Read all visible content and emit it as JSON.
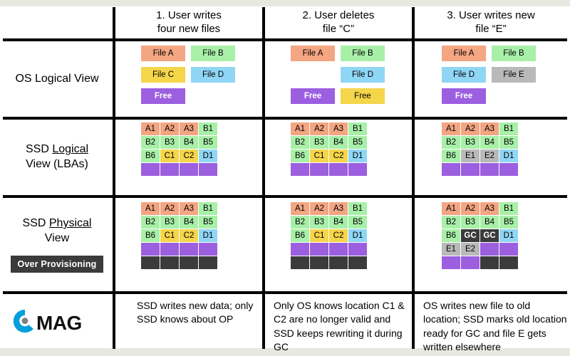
{
  "page": {
    "title": "SSD Over Provisioning and Garbage Collection Diagram",
    "band_color": "#e8e8e0"
  },
  "palette": {
    "orange": "#f4a582",
    "green": "#a8f0a8",
    "yellow": "#f5d54a",
    "blue": "#8fd6f5",
    "purple": "#9b5fe0",
    "gray": "#b9b9b9",
    "dark": "#3b3b3b",
    "white": "#ffffff",
    "rule": "#000000",
    "logo_blue": "#00a0dc",
    "logo_dot": "#808080",
    "logo_text": "#111111"
  },
  "columns": [
    {
      "id": "col1",
      "header_line1": "1. User writes",
      "header_line2": "four  new files"
    },
    {
      "id": "col2",
      "header_line1": "2. User deletes",
      "header_line2": "file “C”"
    },
    {
      "id": "col3",
      "header_line1": "3. User writes new",
      "header_line2": "file “E”"
    }
  ],
  "rows": {
    "os_logical": {
      "label_line1": "OS Logical",
      "label_line2": "View"
    },
    "ssd_logical": {
      "label_pre": "SSD ",
      "label_underlined": "Logical",
      "label_line2": "View (LBAs)"
    },
    "ssd_physical": {
      "label_pre": "SSD ",
      "label_underlined": "Physical",
      "label_line2": "View",
      "badge": "Over Provisioning"
    }
  },
  "os_view": {
    "col1": [
      [
        {
          "label": "File A",
          "color": "orange"
        },
        {
          "label": "File B",
          "color": "green"
        }
      ],
      [
        {
          "label": "File C",
          "color": "yellow"
        },
        {
          "label": "File D",
          "color": "blue"
        }
      ],
      [
        {
          "label": "Free",
          "color": "purple"
        },
        {
          "label": "",
          "color": "empty"
        }
      ]
    ],
    "col2": [
      [
        {
          "label": "File A",
          "color": "orange"
        },
        {
          "label": "File B",
          "color": "green"
        }
      ],
      [
        {
          "label": "",
          "color": "empty"
        },
        {
          "label": "File D",
          "color": "blue"
        }
      ],
      [
        {
          "label": "Free",
          "color": "purple"
        },
        {
          "label": "Free",
          "color": "yellow"
        }
      ]
    ],
    "col3": [
      [
        {
          "label": "File A",
          "color": "orange"
        },
        {
          "label": "File B",
          "color": "green"
        }
      ],
      [
        {
          "label": "File D",
          "color": "blue"
        },
        {
          "label": "File E",
          "color": "gray"
        }
      ],
      [
        {
          "label": "Free",
          "color": "purple"
        },
        {
          "label": "",
          "color": "empty"
        }
      ]
    ]
  },
  "ssd_logical_view": {
    "col1": [
      [
        {
          "t": "A1",
          "c": "orange"
        },
        {
          "t": "A2",
          "c": "orange"
        },
        {
          "t": "A3",
          "c": "orange"
        },
        {
          "t": "B1",
          "c": "green"
        }
      ],
      [
        {
          "t": "B2",
          "c": "green"
        },
        {
          "t": "B3",
          "c": "green"
        },
        {
          "t": "B4",
          "c": "green"
        },
        {
          "t": "B5",
          "c": "green"
        }
      ],
      [
        {
          "t": "B6",
          "c": "green"
        },
        {
          "t": "C1",
          "c": "yellow"
        },
        {
          "t": "C2",
          "c": "yellow"
        },
        {
          "t": "D1",
          "c": "blue"
        }
      ],
      [
        {
          "t": "",
          "c": "purple"
        },
        {
          "t": "",
          "c": "purple"
        },
        {
          "t": "",
          "c": "purple"
        },
        {
          "t": "",
          "c": "purple"
        }
      ]
    ],
    "col2": [
      [
        {
          "t": "A1",
          "c": "orange"
        },
        {
          "t": "A2",
          "c": "orange"
        },
        {
          "t": "A3",
          "c": "orange"
        },
        {
          "t": "B1",
          "c": "green"
        }
      ],
      [
        {
          "t": "B2",
          "c": "green"
        },
        {
          "t": "B3",
          "c": "green"
        },
        {
          "t": "B4",
          "c": "green"
        },
        {
          "t": "B5",
          "c": "green"
        }
      ],
      [
        {
          "t": "B6",
          "c": "green"
        },
        {
          "t": "C1",
          "c": "yellow"
        },
        {
          "t": "C2",
          "c": "yellow"
        },
        {
          "t": "D1",
          "c": "blue"
        }
      ],
      [
        {
          "t": "",
          "c": "purple"
        },
        {
          "t": "",
          "c": "purple"
        },
        {
          "t": "",
          "c": "purple"
        },
        {
          "t": "",
          "c": "purple"
        }
      ]
    ],
    "col3": [
      [
        {
          "t": "A1",
          "c": "orange"
        },
        {
          "t": "A2",
          "c": "orange"
        },
        {
          "t": "A3",
          "c": "orange"
        },
        {
          "t": "B1",
          "c": "green"
        }
      ],
      [
        {
          "t": "B2",
          "c": "green"
        },
        {
          "t": "B3",
          "c": "green"
        },
        {
          "t": "B4",
          "c": "green"
        },
        {
          "t": "B5",
          "c": "green"
        }
      ],
      [
        {
          "t": "B6",
          "c": "green"
        },
        {
          "t": "E1",
          "c": "gray"
        },
        {
          "t": "E2",
          "c": "gray"
        },
        {
          "t": "D1",
          "c": "blue"
        }
      ],
      [
        {
          "t": "",
          "c": "purple"
        },
        {
          "t": "",
          "c": "purple"
        },
        {
          "t": "",
          "c": "purple"
        },
        {
          "t": "",
          "c": "purple"
        }
      ]
    ]
  },
  "ssd_physical_view": {
    "col1": [
      [
        {
          "t": "A1",
          "c": "orange"
        },
        {
          "t": "A2",
          "c": "orange"
        },
        {
          "t": "A3",
          "c": "orange"
        },
        {
          "t": "B1",
          "c": "green"
        }
      ],
      [
        {
          "t": "B2",
          "c": "green"
        },
        {
          "t": "B3",
          "c": "green"
        },
        {
          "t": "B4",
          "c": "green"
        },
        {
          "t": "B5",
          "c": "green"
        }
      ],
      [
        {
          "t": "B6",
          "c": "green"
        },
        {
          "t": "C1",
          "c": "yellow"
        },
        {
          "t": "C2",
          "c": "yellow"
        },
        {
          "t": "D1",
          "c": "blue"
        }
      ],
      [
        {
          "t": "",
          "c": "purple"
        },
        {
          "t": "",
          "c": "purple"
        },
        {
          "t": "",
          "c": "purple"
        },
        {
          "t": "",
          "c": "purple"
        }
      ],
      [
        {
          "t": "",
          "c": "dark"
        },
        {
          "t": "",
          "c": "dark"
        },
        {
          "t": "",
          "c": "dark"
        },
        {
          "t": "",
          "c": "dark"
        }
      ]
    ],
    "col2": [
      [
        {
          "t": "A1",
          "c": "orange"
        },
        {
          "t": "A2",
          "c": "orange"
        },
        {
          "t": "A3",
          "c": "orange"
        },
        {
          "t": "B1",
          "c": "green"
        }
      ],
      [
        {
          "t": "B2",
          "c": "green"
        },
        {
          "t": "B3",
          "c": "green"
        },
        {
          "t": "B4",
          "c": "green"
        },
        {
          "t": "B5",
          "c": "green"
        }
      ],
      [
        {
          "t": "B6",
          "c": "green"
        },
        {
          "t": "C1",
          "c": "yellow"
        },
        {
          "t": "C2",
          "c": "yellow"
        },
        {
          "t": "D1",
          "c": "blue"
        }
      ],
      [
        {
          "t": "",
          "c": "purple"
        },
        {
          "t": "",
          "c": "purple"
        },
        {
          "t": "",
          "c": "purple"
        },
        {
          "t": "",
          "c": "purple"
        }
      ],
      [
        {
          "t": "",
          "c": "dark"
        },
        {
          "t": "",
          "c": "dark"
        },
        {
          "t": "",
          "c": "dark"
        },
        {
          "t": "",
          "c": "dark"
        }
      ]
    ],
    "col3": [
      [
        {
          "t": "A1",
          "c": "orange"
        },
        {
          "t": "A2",
          "c": "orange"
        },
        {
          "t": "A3",
          "c": "orange"
        },
        {
          "t": "B1",
          "c": "green"
        }
      ],
      [
        {
          "t": "B2",
          "c": "green"
        },
        {
          "t": "B3",
          "c": "green"
        },
        {
          "t": "B4",
          "c": "green"
        },
        {
          "t": "B5",
          "c": "green"
        }
      ],
      [
        {
          "t": "B6",
          "c": "green"
        },
        {
          "t": "GC",
          "c": "dark"
        },
        {
          "t": "GC",
          "c": "dark"
        },
        {
          "t": "D1",
          "c": "blue"
        }
      ],
      [
        {
          "t": "E1",
          "c": "gray"
        },
        {
          "t": "E2",
          "c": "gray"
        },
        {
          "t": "",
          "c": "purple"
        },
        {
          "t": "",
          "c": "purple"
        }
      ],
      [
        {
          "t": "",
          "c": "purple"
        },
        {
          "t": "",
          "c": "purple"
        },
        {
          "t": "",
          "c": "dark"
        },
        {
          "t": "",
          "c": "dark"
        }
      ]
    ]
  },
  "captions": {
    "col1": "SSD writes new data; only SSD knows about OP",
    "col2": "Only OS knows location C1 & C2 are no longer valid and SSD keeps rewriting it during GC",
    "col3": "OS writes new file to old location; SSD marks old location ready for GC and file E gets written elsewhere"
  },
  "logo": {
    "mark": "c-swirl-logo",
    "text": "MAG"
  }
}
